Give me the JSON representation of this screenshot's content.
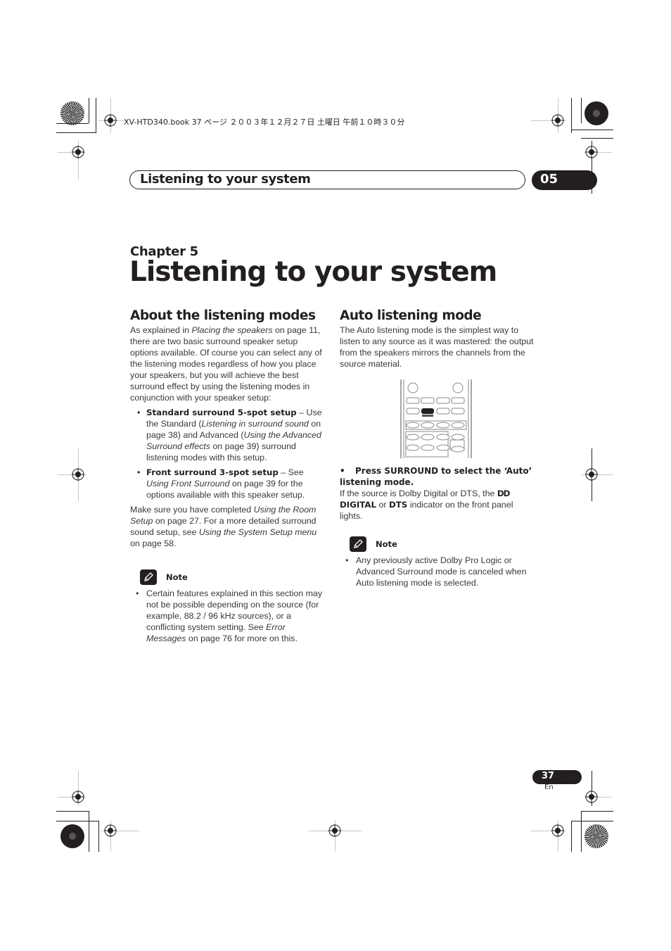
{
  "print_info": "XV-HTD340.book  37 ページ  ２００３年１２月２７日  土曜日  午前１０時３０分",
  "header": {
    "title": "Listening to your system",
    "chapter_number": "05"
  },
  "chapter": {
    "label": "Chapter 5",
    "title": "Listening to your system"
  },
  "left_column": {
    "heading": "About the listening modes",
    "intro": {
      "t1": "As explained in ",
      "i1": "Placing the speakers",
      "t2": " on page 11, there are two basic surround speaker setup options available. Of course you can select any of the listening modes regardless of how you place your speakers, but you will achieve the best surround effect by using the listening modes in conjunction with your speaker setup:"
    },
    "bullets": [
      {
        "bold": "Standard surround 5-spot setup",
        "t1": " – Use the Standard (",
        "i1": "Listening in surround sound",
        "t2": " on page 38) and Advanced (",
        "i2": "Using the Advanced Surround effects",
        "t3": " on page 39) surround listening modes with this setup."
      },
      {
        "bold": "Front surround 3-spot setup",
        "t1": " – See ",
        "i1": "Using Front Surround",
        "t2": " on page 39 for the options available with this speaker setup."
      }
    ],
    "followup": {
      "t1": "Make sure you have completed ",
      "i1": "Using the Room Setup",
      "t2": " on page 27. For a more detailed surround sound setup, see ",
      "i2": "Using the System Setup menu",
      "t3": " on page 58."
    },
    "note": {
      "label": "Note",
      "icon": "pencil-icon",
      "items": [
        {
          "t1": "Certain features explained in this section may not be possible depending on the source (for example, 88.2 / 96 kHz sources), or a conflicting system setting. See ",
          "i1": "Error Messages",
          "t2": " on page 76 for more on this."
        }
      ]
    }
  },
  "right_column": {
    "heading": "Auto listening mode",
    "intro": "The Auto listening mode is the simplest way to listen to any source as it was mastered: the output from the speakers mirrors the channels from the source material.",
    "illustration": {
      "highlighted_button": "SURROUND"
    },
    "step": {
      "bullet": "•",
      "text": "Press SURROUND to select the ‘Auto’ listening mode."
    },
    "step_detail": {
      "t1": "If the source is Dolby Digital or DTS, the ",
      "dolby_symbol": "DD",
      "b1": "DIGITAL",
      "t2": " or ",
      "b2": "DTS",
      "t3": " indicator on the front panel lights."
    },
    "note": {
      "label": "Note",
      "icon": "pencil-icon",
      "items": [
        "Any previously active Dolby Pro Logic or Advanced Surround mode is canceled when Auto listening mode is selected."
      ]
    }
  },
  "footer": {
    "page_number": "37",
    "language": "En"
  }
}
